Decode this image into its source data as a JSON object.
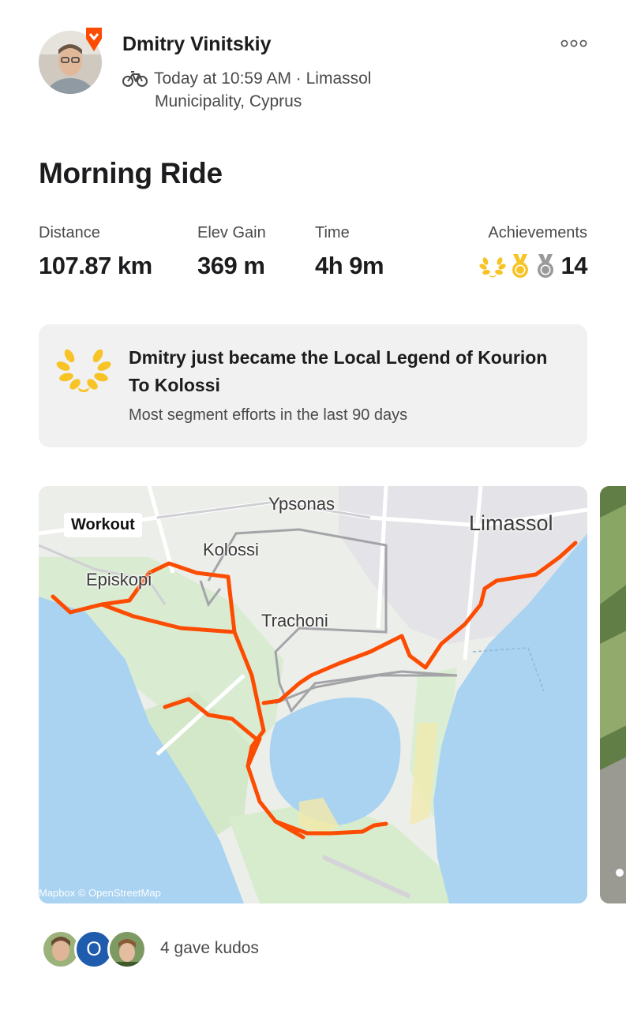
{
  "athlete": {
    "name": "Dmitry Vinitskiy",
    "subscriber_badge_color": "#fc4c02"
  },
  "activity_meta": {
    "sport_icon": "bike-icon",
    "timestamp_location_line1": "Today at 10:59 AM · Limassol",
    "timestamp_location_line2": "Municipality, Cyprus"
  },
  "title": "Morning Ride",
  "stats": {
    "distance_label": "Distance",
    "distance_value": "107.87 km",
    "elev_label": "Elev Gain",
    "elev_value": "369 m",
    "time_label": "Time",
    "time_value": "4h 9m",
    "achievements_label": "Achievements",
    "achievements_value": "14",
    "achievement_icons": [
      "local-legend-laurel-icon",
      "gold-medal-icon",
      "silver-medal-icon"
    ]
  },
  "local_legend": {
    "icon": "laurel-icon",
    "headline": "Dmitry just became the Local Legend of Kourion To Kolossi",
    "subtitle": "Most segment efforts in the last 90 days"
  },
  "map": {
    "tag": "Workout",
    "labels": {
      "ypsonas": "Ypsonas",
      "limassol": "Limassol",
      "kolossi": "Kolossi",
      "episkopi": "Episkopi",
      "trachoni": "Trachoni"
    },
    "attribution": "Mapbox © OpenStreetMap",
    "route_color": "#fc4c02",
    "water_color": "#aad3f2"
  },
  "kudos": {
    "avatar_letter": "O",
    "text": "4 gave kudos"
  },
  "colors": {
    "gold": "#f7c325",
    "silver": "#9a9a9a",
    "card_bg": "#f1f1f1"
  }
}
